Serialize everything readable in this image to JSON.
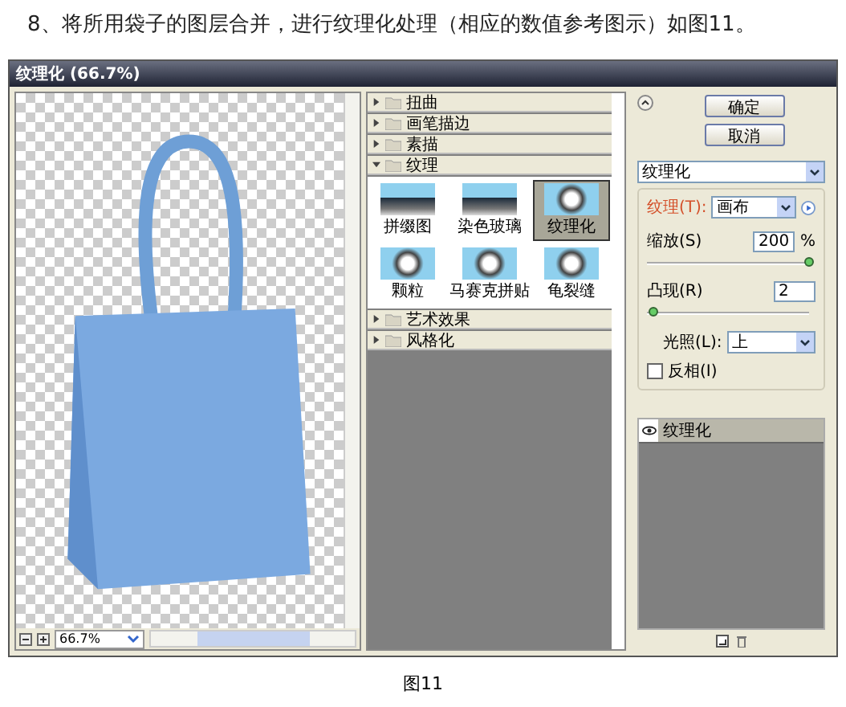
{
  "caption": "8、将所用袋子的图层合并，进行纹理化处理（相应的数值参考图示）如图11。",
  "window": {
    "title": "纹理化 (66.7%)"
  },
  "preview": {
    "zoom": "66.7%"
  },
  "filter_gallery": {
    "categories": [
      {
        "label": "扭曲",
        "expanded": false
      },
      {
        "label": "画笔描边",
        "expanded": false
      },
      {
        "label": "素描",
        "expanded": false
      },
      {
        "label": "纹理",
        "expanded": true,
        "filters": [
          {
            "label": "拼缀图",
            "selected": false
          },
          {
            "label": "染色玻璃",
            "selected": false
          },
          {
            "label": "纹理化",
            "selected": true
          },
          {
            "label": "颗粒",
            "selected": false
          },
          {
            "label": "马赛克拼贴",
            "selected": false
          },
          {
            "label": "龟裂缝",
            "selected": false
          }
        ]
      },
      {
        "label": "艺术效果",
        "expanded": false
      },
      {
        "label": "风格化",
        "expanded": false
      }
    ]
  },
  "buttons": [
    "确定",
    "取消"
  ],
  "filter_select": {
    "value": "纹理化"
  },
  "settings": {
    "texture": {
      "label": "纹理(T):",
      "value": "画布"
    },
    "scaling": {
      "label": "缩放(S)",
      "value": "200",
      "unit": "%",
      "level": 1.0
    },
    "relief": {
      "label": "凸现(R)",
      "value": "2",
      "level": 0.04
    },
    "light": {
      "label": "光照(L):",
      "value": "上"
    },
    "invert": {
      "label": "反相(I)",
      "checked": false
    }
  },
  "layers": [
    {
      "label": "纹理化",
      "visible": true
    }
  ],
  "figure_caption": "图11"
}
